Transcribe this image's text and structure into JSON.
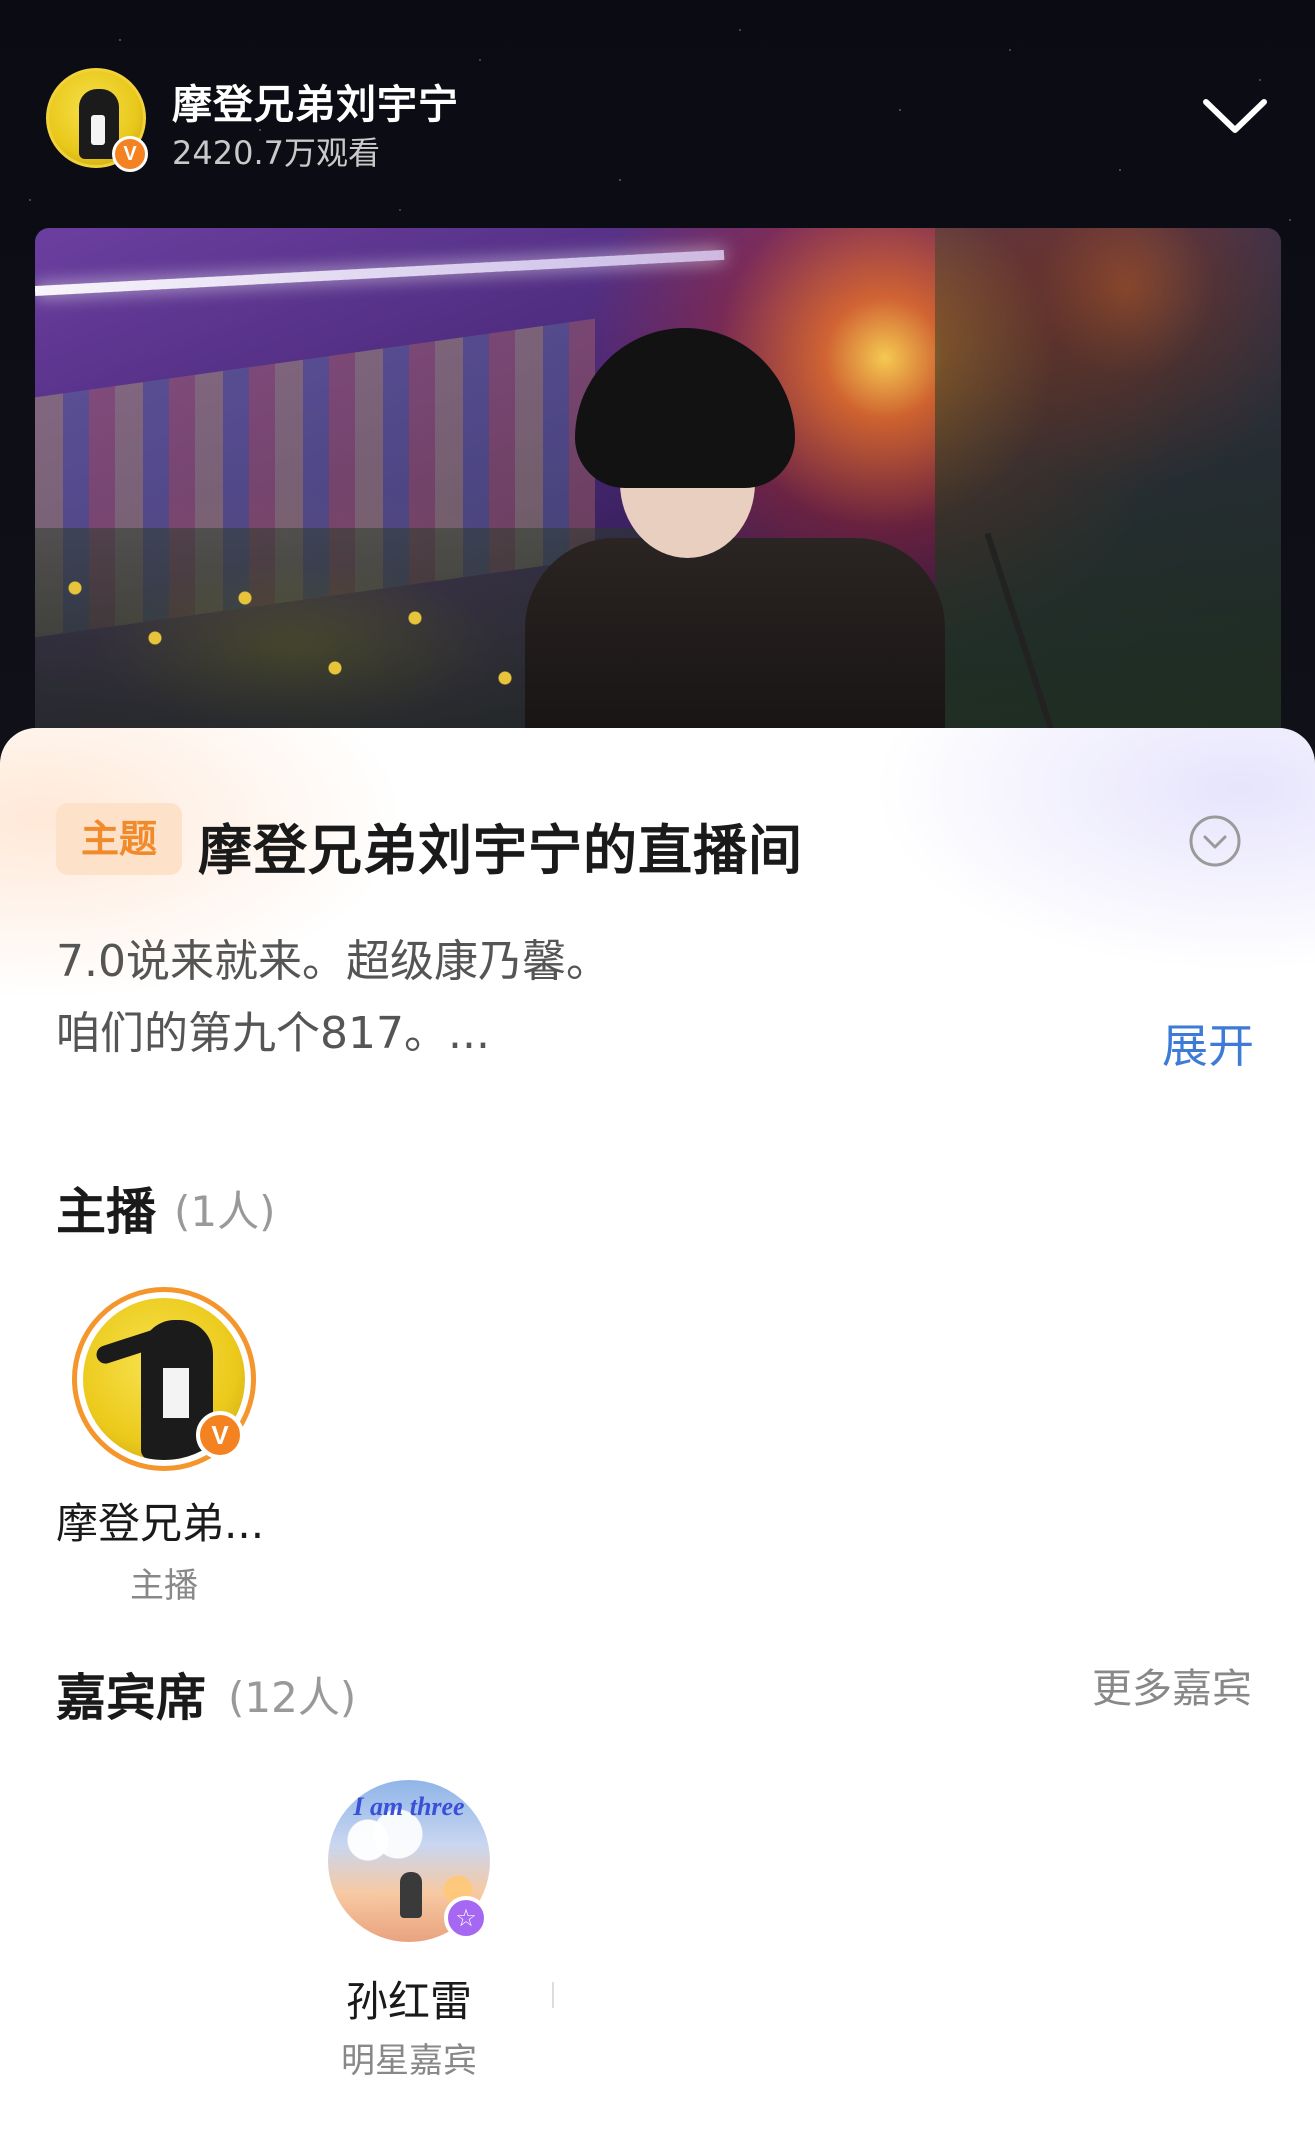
{
  "header": {
    "host_name": "摩登兄弟刘宇宁",
    "view_count": "2420.7万观看",
    "verified_badge": "V"
  },
  "room": {
    "topic_tag": "主题",
    "title": "摩登兄弟刘宇宁的直播间",
    "description_line1": "7.0说来就来。超级康乃馨。",
    "description_line2": "咱们的第九个817。...",
    "expand_label": "展开"
  },
  "hosts": {
    "section_title": "主播",
    "count": "(1人)",
    "items": [
      {
        "name": "摩登兄弟...",
        "role": "主播",
        "badge": "V"
      }
    ]
  },
  "guests": {
    "section_title": "嘉宾席",
    "count": "(12人)",
    "more_label": "更多嘉宾",
    "items": [
      {
        "avatar_text": "I am three",
        "name": "孙红雷",
        "role": "明星嘉宾",
        "badge": "☆"
      }
    ]
  },
  "colors": {
    "accent_orange": "#f58220",
    "link_blue": "#3d7bd6",
    "guest_badge_purple": "#a668f2"
  }
}
